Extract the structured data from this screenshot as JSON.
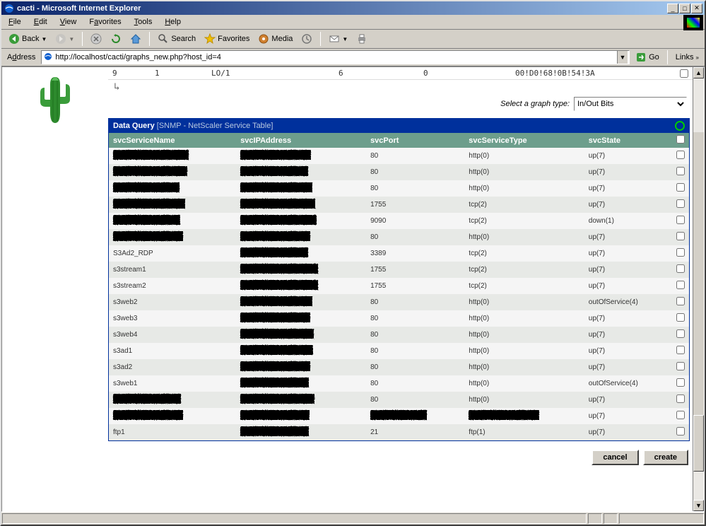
{
  "window": {
    "title": "cacti - Microsoft Internet Explorer"
  },
  "menubar": {
    "file": "File",
    "edit": "Edit",
    "view": "View",
    "favorites": "Favorites",
    "tools": "Tools",
    "help": "Help"
  },
  "toolbar": {
    "back": "Back",
    "search": "Search",
    "favorites": "Favorites",
    "media": "Media"
  },
  "addressbar": {
    "label": "Address",
    "url": "http://localhost/cacti/graphs_new.php?host_id=4",
    "go": "Go",
    "links": "Links"
  },
  "partial_row": {
    "c1": "9",
    "c2": "1",
    "c3": "LO/1",
    "c4": "6",
    "c5": "0",
    "c6": "00!D0!68!0B!54!3A"
  },
  "graph_selector": {
    "label": "Select a graph type:",
    "selected": "In/Out Bits"
  },
  "data_query": {
    "title": "Data Query",
    "subtitle": "[SNMP - NetScaler Service Table]",
    "columns": {
      "svcServiceName": "svcServiceName",
      "svcIPAddress": "svcIPAddress",
      "svcPort": "svcPort",
      "svcServiceType": "svcServiceType",
      "svcState": "svcState"
    },
    "rows": [
      {
        "name_redacted": true,
        "ip_redacted": true,
        "port": "80",
        "type": "http(0)",
        "state": "up(7)"
      },
      {
        "name_redacted": true,
        "ip_redacted": true,
        "port": "80",
        "type": "http(0)",
        "state": "up(7)"
      },
      {
        "name_redacted": true,
        "ip_redacted": true,
        "port": "80",
        "type": "http(0)",
        "state": "up(7)"
      },
      {
        "name_redacted": true,
        "ip_redacted": true,
        "port": "1755",
        "type": "tcp(2)",
        "state": "up(7)"
      },
      {
        "name_redacted": true,
        "ip_redacted": true,
        "port": "9090",
        "type": "tcp(2)",
        "state": "down(1)"
      },
      {
        "name_redacted": true,
        "ip_redacted": true,
        "port": "80",
        "type": "http(0)",
        "state": "up(7)"
      },
      {
        "name": "S3Ad2_RDP",
        "ip_redacted": true,
        "port": "3389",
        "type": "tcp(2)",
        "state": "up(7)"
      },
      {
        "name": "s3stream1",
        "ip_redacted": true,
        "port": "1755",
        "type": "tcp(2)",
        "state": "up(7)"
      },
      {
        "name": "s3stream2",
        "ip_redacted": true,
        "port": "1755",
        "type": "tcp(2)",
        "state": "up(7)"
      },
      {
        "name": "s3web2",
        "ip_redacted": true,
        "port": "80",
        "type": "http(0)",
        "state": "outOfService(4)"
      },
      {
        "name": "s3web3",
        "ip_redacted": true,
        "port": "80",
        "type": "http(0)",
        "state": "up(7)"
      },
      {
        "name": "s3web4",
        "ip_redacted": true,
        "port": "80",
        "type": "http(0)",
        "state": "up(7)"
      },
      {
        "name": "s3ad1",
        "ip_redacted": true,
        "port": "80",
        "type": "http(0)",
        "state": "up(7)"
      },
      {
        "name": "s3ad2",
        "ip_redacted": true,
        "port": "80",
        "type": "http(0)",
        "state": "up(7)"
      },
      {
        "name": "s3web1",
        "ip_redacted": true,
        "port": "80",
        "type": "http(0)",
        "state": "outOfService(4)"
      },
      {
        "name_redacted": true,
        "ip_redacted": true,
        "port": "80",
        "type": "http(0)",
        "state": "up(7)"
      },
      {
        "name_redacted": true,
        "ip_redacted": true,
        "port_redacted": true,
        "type_redacted": true,
        "state": "up(7)"
      },
      {
        "name": "ftp1",
        "ip_redacted": true,
        "port": "21",
        "type": "ftp(1)",
        "state": "up(7)"
      }
    ]
  },
  "buttons": {
    "cancel": "cancel",
    "create": "create"
  }
}
